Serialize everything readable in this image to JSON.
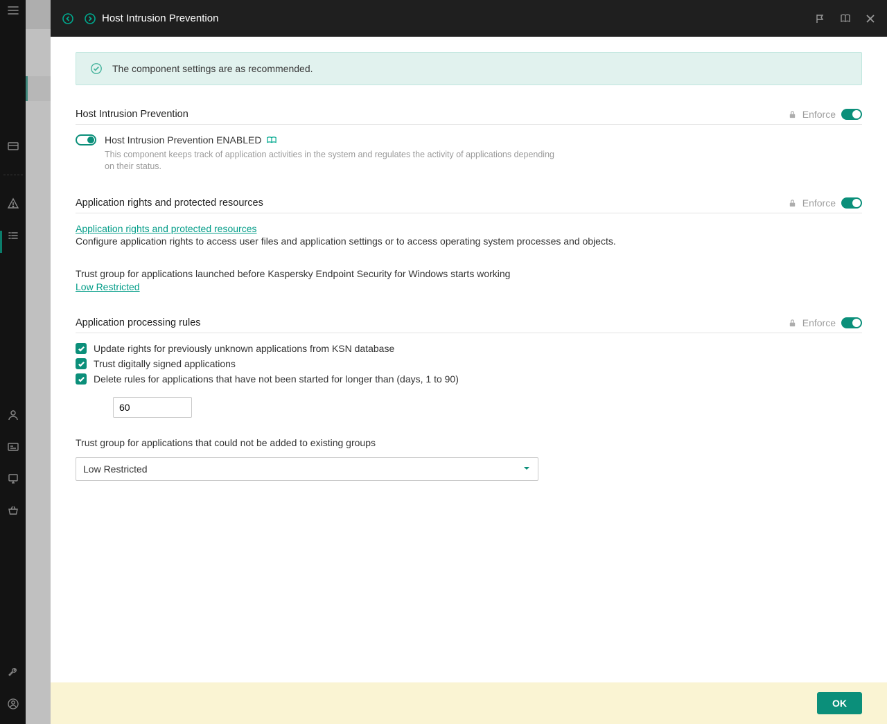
{
  "header": {
    "title": "Host Intrusion Prevention"
  },
  "banner": {
    "text": "The component settings are as recommended."
  },
  "sections": {
    "hip": {
      "title": "Host Intrusion Prevention",
      "enforce": "Enforce",
      "status_label": "Host Intrusion Prevention ENABLED",
      "description": "This component keeps track of application activities in the system and regulates the activity of applications depending on their status."
    },
    "rights": {
      "title": "Application rights and protected resources",
      "enforce": "Enforce",
      "link": "Application rights and protected resources",
      "desc": "Configure application rights to access user files and application settings or to access operating system processes and objects.",
      "trust_label": "Trust group for applications launched before Kaspersky Endpoint Security for Windows starts working",
      "trust_value": "Low Restricted"
    },
    "rules": {
      "title": "Application processing rules",
      "enforce": "Enforce",
      "cb1": "Update rights for previously unknown applications from KSN database",
      "cb2": "Trust digitally signed applications",
      "cb3": "Delete rules for applications that have not been started for longer than (days, 1 to 90)",
      "days_value": "60",
      "trust_group_label": "Trust group for applications that could not be added to existing groups",
      "trust_group_value": "Low Restricted"
    }
  },
  "footer": {
    "ok": "OK"
  }
}
